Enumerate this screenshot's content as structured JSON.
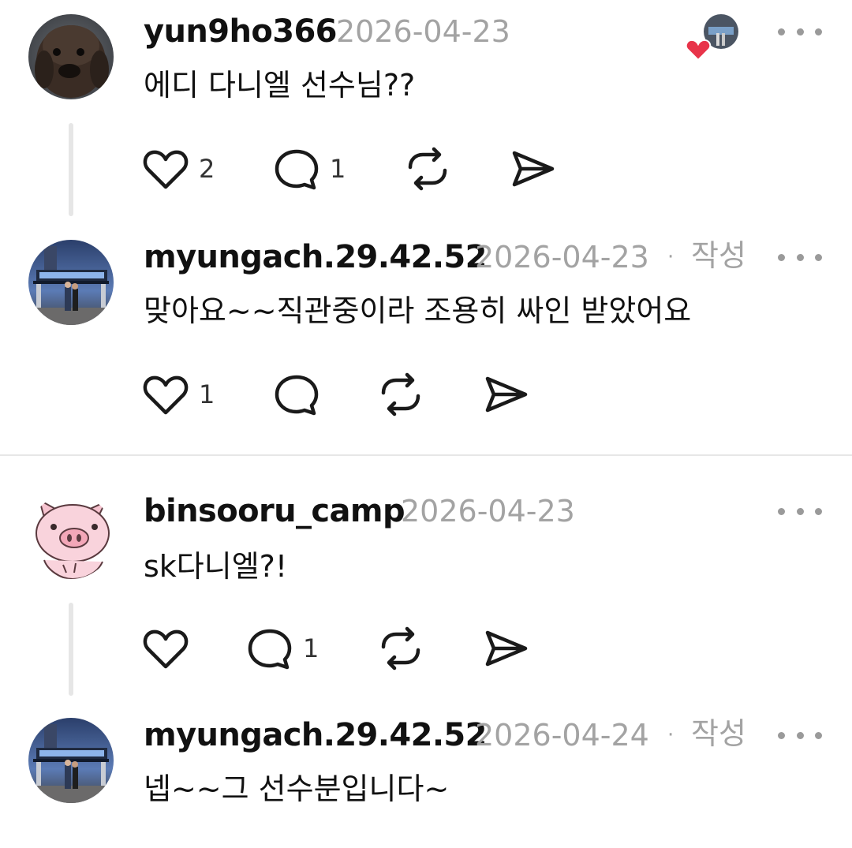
{
  "comments": [
    {
      "username": "yun9ho366",
      "date": "2026-04-23",
      "text": "에디 다니엘 선수님??",
      "likes": "2",
      "replies": "1",
      "avatar_icon": "dog-photo-avatar"
    },
    {
      "username": "myungach.29.42.52",
      "date": "2026-04-23",
      "author_label": "작성",
      "text": "맞아요~~직관중이라 조용히 싸인 받았어요",
      "likes": "1",
      "avatar_icon": "stadium-photo-avatar"
    },
    {
      "username": "binsooru_camp",
      "date": "2026-04-23",
      "text": "sk다니엘?!",
      "replies": "1",
      "avatar_icon": "pig-cartoon-avatar"
    },
    {
      "username": "myungach.29.42.52",
      "date": "2026-04-24",
      "author_label": "작성",
      "text": "넵~~그 선수분입니다~",
      "avatar_icon": "stadium-photo-avatar"
    }
  ],
  "colors": {
    "text": "#111111",
    "muted": "#a3a3a3",
    "heart_badge": "#e8344a",
    "thread_line": "#e6e6e6"
  },
  "icons": [
    "heart-icon",
    "comment-icon",
    "repost-icon",
    "share-icon",
    "more-icon",
    "author-liked-badge-icon"
  ]
}
